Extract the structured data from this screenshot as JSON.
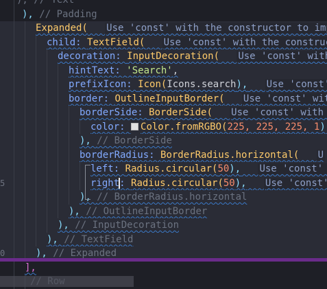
{
  "lines": [
    {
      "gutter": "",
      "indent": 24,
      "tokens": [
        {
          "t": "), // Text",
          "c": "t-com"
        }
      ]
    },
    {
      "gutter": "",
      "indent": 32,
      "tokens": [
        {
          "t": "), ",
          "c": "t-punc"
        },
        {
          "t": "// Padding",
          "c": "t-com"
        }
      ]
    },
    {
      "gutter": "",
      "indent": 52,
      "tokens": [
        {
          "t": "Expanded(",
          "c": "t-cls"
        }
      ],
      "hint": "Use 'const' with the constructor to imp"
    },
    {
      "gutter": "",
      "indent": 68,
      "tokens": [
        {
          "t": "child: ",
          "c": "t-prop"
        },
        {
          "t": "TextField(",
          "c": "t-cls"
        }
      ],
      "hint": "Use 'const' with the construc"
    },
    {
      "gutter": "",
      "indent": 84,
      "tokens": [
        {
          "t": "decoration: ",
          "c": "t-prop"
        },
        {
          "t": "InputDecoration(",
          "c": "t-cls"
        }
      ],
      "hint": "Use 'const' with"
    },
    {
      "gutter": "",
      "indent": 100,
      "tokens": [
        {
          "t": "hintText: ",
          "c": "t-prop"
        },
        {
          "t": "'Search'",
          "c": "t-str"
        },
        {
          "t": ",",
          "c": "t-plain"
        }
      ]
    },
    {
      "gutter": "",
      "indent": 100,
      "tokens": [
        {
          "t": "prefixIcon: ",
          "c": "t-prop"
        },
        {
          "t": "Icon(",
          "c": "t-cls"
        },
        {
          "t": "Icons.search",
          "c": "t-plain"
        },
        {
          "t": "),",
          "c": "t-punc"
        }
      ],
      "hint": "Use 'const'"
    },
    {
      "gutter": "",
      "indent": 100,
      "tokens": [
        {
          "t": "border: ",
          "c": "t-prop"
        },
        {
          "t": "OutlineInputBorder(",
          "c": "t-cls"
        }
      ],
      "hint": "Use 'const' with"
    },
    {
      "gutter": "",
      "indent": 116,
      "tokens": [
        {
          "t": "borderSide: ",
          "c": "t-prop"
        },
        {
          "t": "BorderSide(",
          "c": "t-cls"
        }
      ],
      "hint": "Use 'const' with t"
    },
    {
      "gutter": "",
      "indent": 132,
      "tokens": [
        {
          "t": "color: ",
          "c": "t-prop"
        },
        {
          "swatch": true
        },
        {
          "t": "Color.fromRGBO(",
          "c": "t-cls"
        },
        {
          "t": "225, 225, 225, 1",
          "c": "t-num"
        },
        {
          "t": "),",
          "c": "t-punc"
        }
      ]
    },
    {
      "gutter": "",
      "indent": 116,
      "tokens": [
        {
          "t": "), ",
          "c": "t-punc"
        },
        {
          "t": "// BorderSide",
          "c": "t-com"
        }
      ]
    },
    {
      "gutter": "",
      "indent": 116,
      "tokens": [
        {
          "t": "borderRadius: ",
          "c": "t-prop"
        },
        {
          "t": "BorderRadius.horizontal(",
          "c": "t-cls"
        }
      ],
      "hint": "U"
    },
    {
      "gutter": "",
      "indent": 132,
      "tokens": [
        {
          "t": "left: ",
          "c": "t-prop"
        },
        {
          "t": "Radius.circular(",
          "c": "t-cls"
        },
        {
          "t": "50",
          "c": "t-num"
        },
        {
          "t": "),",
          "c": "t-punc"
        }
      ],
      "hint": "Use 'const' "
    },
    {
      "gutter": "5",
      "indent": 132,
      "tokens": [
        {
          "t": "right",
          "c": "t-prop"
        },
        {
          "cursor": true
        },
        {
          "t": ": ",
          "c": "t-prop"
        },
        {
          "t": "Radius.circular(",
          "c": "t-cls"
        },
        {
          "t": "50",
          "c": "t-num"
        },
        {
          "t": "),",
          "c": "t-punc"
        }
      ],
      "hint": "Use 'const'"
    },
    {
      "gutter": "",
      "indent": 116,
      "tokens": [
        {
          "t": "), ",
          "c": "t-punc"
        },
        {
          "t": "// BorderRadius.horizontal",
          "c": "t-com"
        }
      ]
    },
    {
      "gutter": "",
      "indent": 100,
      "tokens": [
        {
          "t": "), ",
          "c": "t-punc"
        },
        {
          "t": "// OutlineInputBorder",
          "c": "t-com"
        }
      ]
    },
    {
      "gutter": "",
      "indent": 84,
      "tokens": [
        {
          "t": "), ",
          "c": "t-punc"
        },
        {
          "t": "// InputDecoration",
          "c": "t-com"
        }
      ]
    },
    {
      "gutter": "",
      "indent": 68,
      "tokens": [
        {
          "t": "), ",
          "c": "t-punc"
        },
        {
          "t": "// TextField",
          "c": "t-com"
        }
      ]
    },
    {
      "gutter": "0",
      "indent": 52,
      "tokens": [
        {
          "t": "), ",
          "c": "t-punc"
        },
        {
          "t": "// Expanded",
          "c": "t-com"
        }
      ]
    },
    {
      "gutter": "",
      "indent": 36,
      "tokens": [
        {
          "t": "],",
          "c": "t-pink"
        }
      ]
    },
    {
      "gutter": "",
      "indent": 44,
      "tokens": [
        {
          "t": "// Row",
          "c": "t-com"
        }
      ]
    }
  ]
}
